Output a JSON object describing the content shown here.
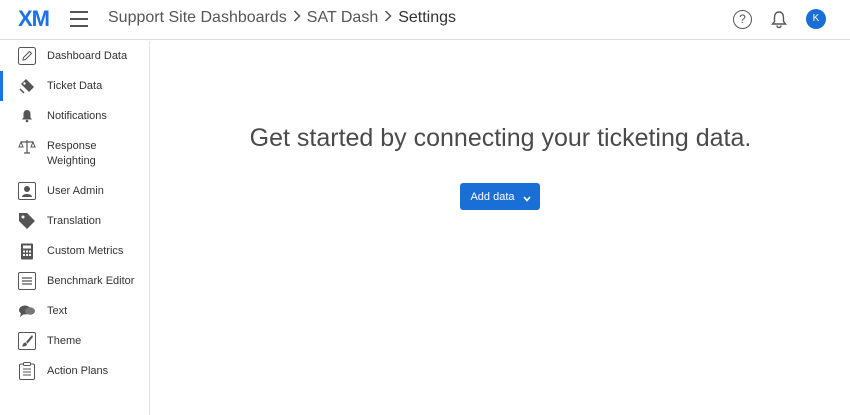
{
  "header": {
    "logo_text": "XM",
    "breadcrumbs": [
      "Support Site Dashboards",
      "SAT Dash",
      "Settings"
    ],
    "help_symbol": "?",
    "avatar_initial": "K",
    "accent_color": "#1a73e8"
  },
  "sidebar": {
    "items": [
      {
        "label": "Dashboard Data",
        "icon": "pencil-icon"
      },
      {
        "label": "Ticket Data",
        "icon": "ticket-tag-icon",
        "active": true
      },
      {
        "label": "Notifications",
        "icon": "bell-icon"
      },
      {
        "label": "Response Weighting",
        "icon": "scale-icon"
      },
      {
        "label": "User Admin",
        "icon": "user-card-icon"
      },
      {
        "label": "Translation",
        "icon": "tag-icon"
      },
      {
        "label": "Custom Metrics",
        "icon": "calculator-icon"
      },
      {
        "label": "Benchmark Editor",
        "icon": "list-icon"
      },
      {
        "label": "Text",
        "icon": "chat-bubbles-icon"
      },
      {
        "label": "Theme",
        "icon": "paintbrush-icon"
      },
      {
        "label": "Action Plans",
        "icon": "clipboard-icon"
      }
    ]
  },
  "main": {
    "headline": "Get started by connecting your ticketing data.",
    "add_button_label": "Add data"
  }
}
